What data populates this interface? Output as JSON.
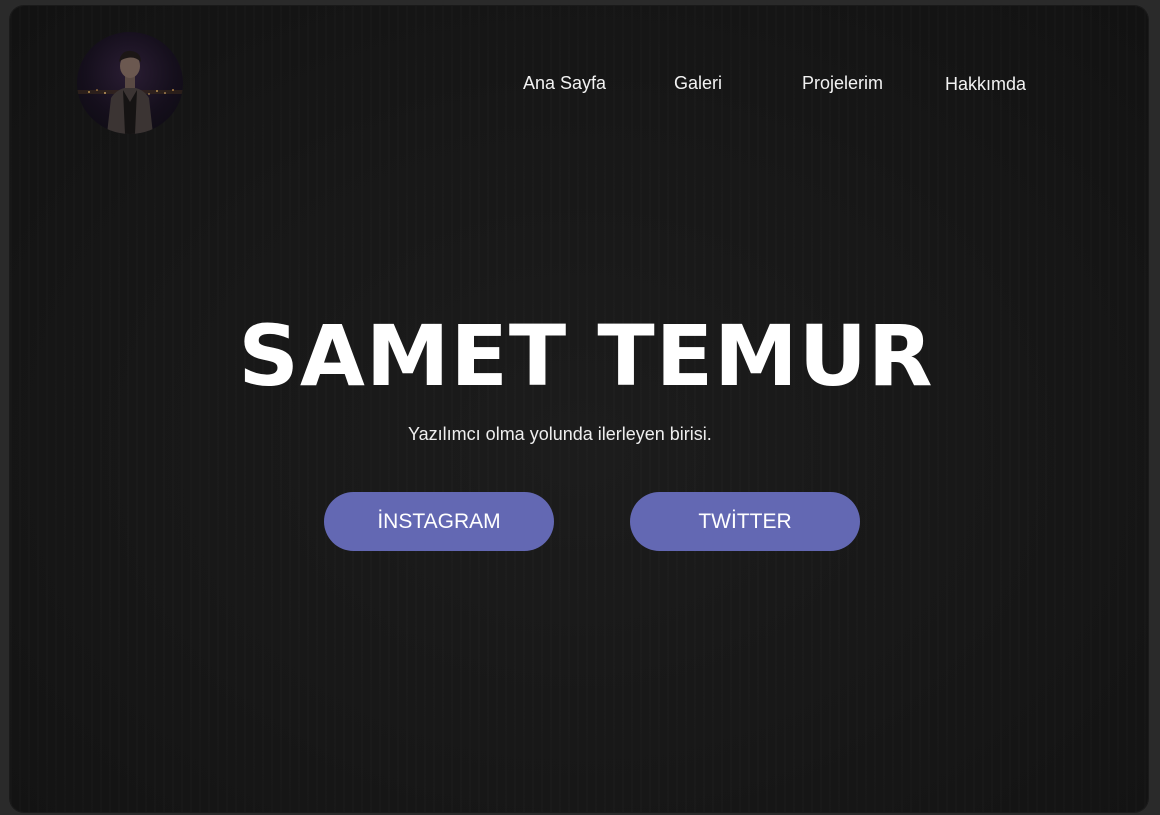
{
  "nav": {
    "items": [
      {
        "label": "Ana Sayfa"
      },
      {
        "label": "Galeri"
      },
      {
        "label": "Projelerim"
      },
      {
        "label": "Hakkımda"
      }
    ]
  },
  "hero": {
    "title": "SAMET TEMUR",
    "subtitle": "Yazılımcı olma yolunda ilerleyen birisi."
  },
  "buttons": {
    "instagram": "İNSTAGRAM",
    "twitter": "TWİTTER"
  },
  "colors": {
    "background": "#161616",
    "accent": "#6368b3",
    "text": "#ffffff"
  }
}
